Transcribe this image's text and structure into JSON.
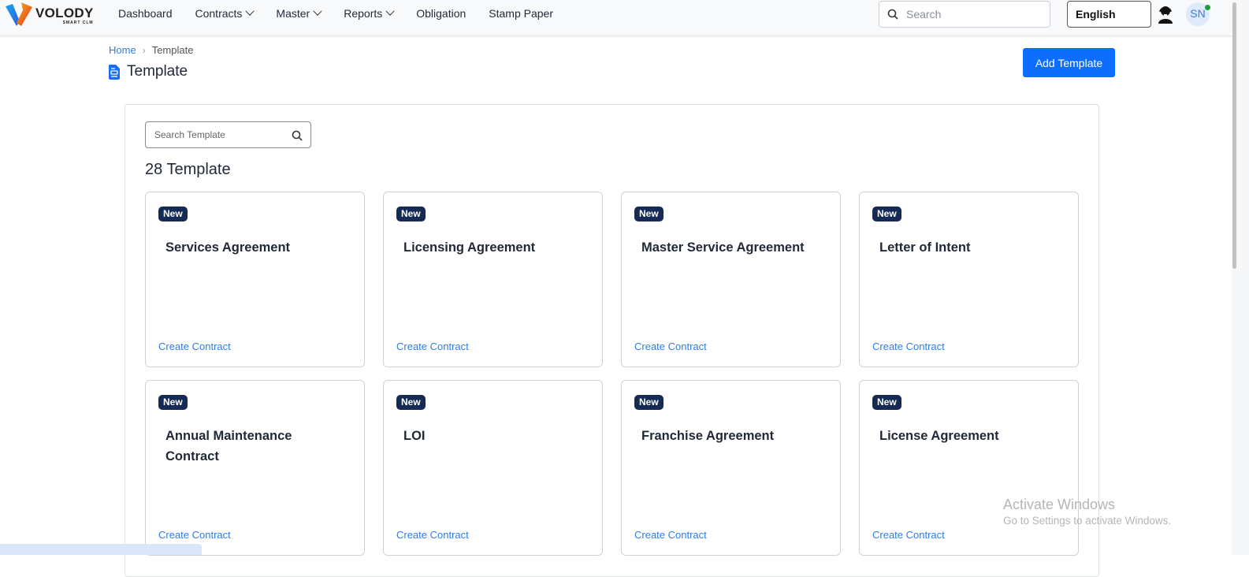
{
  "header": {
    "logo": {
      "name": "VOLODY",
      "subtitle": "SMART CLM"
    },
    "nav": [
      {
        "label": "Dashboard",
        "dropdown": false
      },
      {
        "label": "Contracts",
        "dropdown": true
      },
      {
        "label": "Master",
        "dropdown": true
      },
      {
        "label": "Reports",
        "dropdown": true
      },
      {
        "label": "Obligation",
        "dropdown": false
      },
      {
        "label": "Stamp Paper",
        "dropdown": false
      }
    ],
    "search": {
      "placeholder": "Search",
      "value": ""
    },
    "language": "English",
    "user": {
      "initials": "SN",
      "status": "online"
    }
  },
  "breadcrumb": {
    "home": "Home",
    "current": "Template"
  },
  "page": {
    "title": "Template",
    "add_button": "Add Template"
  },
  "templates": {
    "search": {
      "placeholder": "Search Template",
      "value": ""
    },
    "count_label": "28 Template",
    "cards": [
      {
        "badge": "New",
        "title": "Services Agreement",
        "action": "Create Contract"
      },
      {
        "badge": "New",
        "title": "Licensing Agreement",
        "action": "Create Contract"
      },
      {
        "badge": "New",
        "title": "Master Service Agreement",
        "action": "Create Contract"
      },
      {
        "badge": "New",
        "title": "Letter of Intent",
        "action": "Create Contract"
      },
      {
        "badge": "New",
        "title": "Annual Maintenance Contract",
        "action": "Create Contract"
      },
      {
        "badge": "New",
        "title": "LOI",
        "action": "Create Contract"
      },
      {
        "badge": "New",
        "title": "Franchise Agreement",
        "action": "Create Contract"
      },
      {
        "badge": "New",
        "title": "License Agreement",
        "action": "Create Contract"
      }
    ]
  },
  "watermark": {
    "line1": "Activate Windows",
    "line2": "Go to Settings to activate Windows."
  },
  "colors": {
    "primary": "#0d6efd",
    "link": "#2f7de6",
    "badge": "#152a55",
    "online": "#1d9d3a"
  }
}
